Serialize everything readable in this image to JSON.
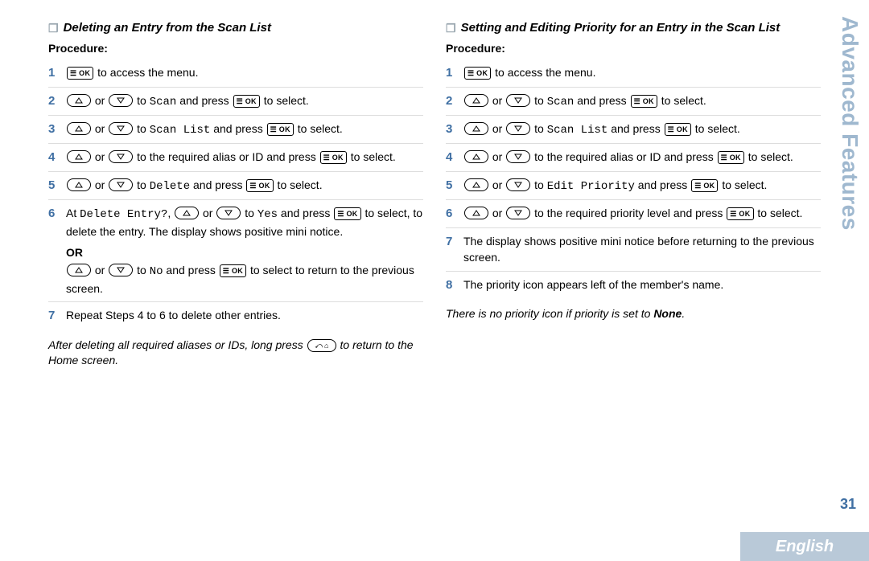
{
  "sidebar_title": "Advanced Features",
  "page_number": "31",
  "lang": "English",
  "keys": {
    "ok": "☰ OK",
    "home": "⤺ ⌂"
  },
  "left": {
    "title": "Deleting an Entry from the Scan List",
    "procedure_label": "Procedure:",
    "steps": {
      "s1_tail": " to access the menu.",
      "s2_mid_a": " or ",
      "s2_mid_b": " to ",
      "s2_scan": "Scan",
      "s2_press": " and press ",
      "s2_tail": " to select.",
      "s3_scanlist": "Scan List",
      "s4_mid": " to the required alias or ID and press ",
      "s4_tail": " to select.",
      "s5_delete": "Delete",
      "s6_pre": "At ",
      "s6_de": "Delete Entry?",
      "s6_sep": ", ",
      "s6_yes": "Yes",
      "s6_tail": " to select, to delete the entry. The display shows positive mini notice.",
      "s6_or": "OR",
      "s6_no": "No",
      "s6_no_tail": " to select to return to the previous screen.",
      "s7": "Repeat Steps 4 to 6 to delete other entries."
    },
    "note_pre": "After deleting all required aliases or IDs, long press ",
    "note_post": " to return to the Home screen."
  },
  "right": {
    "title": "Setting and Editing Priority for an Entry in the Scan List",
    "procedure_label": "Procedure:",
    "steps": {
      "s5_edit": "Edit Priority",
      "s6_mid": " to the required priority level and press ",
      "s7": "The display shows positive mini notice before returning to the previous screen.",
      "s8": "The priority icon appears left of the member's name."
    },
    "note_pre": "There is no priority icon if priority is set to ",
    "note_bold": "None",
    "note_post": "."
  }
}
